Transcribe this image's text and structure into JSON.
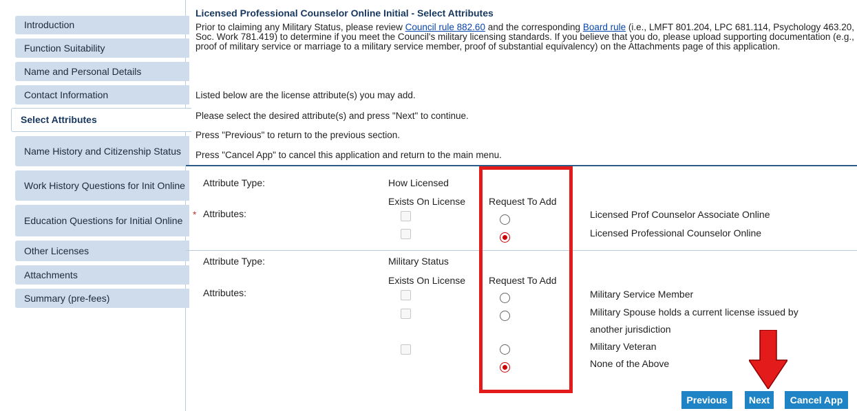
{
  "sidebar": {
    "items": [
      {
        "label": "Introduction"
      },
      {
        "label": "Function Suitability"
      },
      {
        "label": "Name and Personal Details"
      },
      {
        "label": "Contact Information"
      },
      {
        "label": "Select Attributes"
      },
      {
        "label": "Name History and Citizenship Status"
      },
      {
        "label": "Work History Questions for Init Online"
      },
      {
        "label": "Education Questions for Initial Online"
      },
      {
        "label": "Other Licenses"
      },
      {
        "label": "Attachments"
      },
      {
        "label": "Summary (pre-fees)"
      }
    ],
    "active_index": 4
  },
  "main": {
    "title": "Licensed Professional Counselor Online Initial - Select Attributes",
    "intro": {
      "pre": "Prior to claiming any Military Status, please review ",
      "link1": "Council rule 882.60",
      "mid": " and the corresponding ",
      "link2": "Board rule",
      "post": " (i.e., LMFT 801.204, LPC 681.114, Psychology 463.20, Soc. Work 781.419) to determine if you meet the Council's military licensing standards. If you believe that you do, please upload supporting documentation (e.g., proof of military service or marriage to a military service member, proof of substantial equivalency) on the Attachments page of this application."
    },
    "lines": [
      "Listed below are the license attribute(s) you may add.",
      "Please select the desired attribute(s) and press \"Next\" to continue.",
      "Press \"Previous\" to return to the previous section.",
      "Press \"Cancel App\" to cancel this application and return to the main menu."
    ]
  },
  "sections": [
    {
      "type_label": "Attribute Type:",
      "type_value": "How Licensed",
      "col_exists": "Exists On License",
      "col_request": "Request To Add",
      "required_marker": "*",
      "attributes_label": "Attributes:",
      "options": [
        {
          "label": "Licensed Prof Counselor Associate Online",
          "checked": false
        },
        {
          "label": "Licensed Professional Counselor Online",
          "checked": true
        }
      ]
    },
    {
      "type_label": "Attribute Type:",
      "type_value": "Military Status",
      "col_exists": "Exists On License",
      "col_request": "Request To Add",
      "attributes_label": "Attributes:",
      "options": [
        {
          "label": "Military Service Member",
          "checked": false
        },
        {
          "label": "Military Spouse holds a current license issued by",
          "label2": "another jurisdiction",
          "checked": false
        },
        {
          "label": "Military Veteran",
          "checked": false
        },
        {
          "label": "None of the Above",
          "checked": true
        }
      ]
    }
  ],
  "buttons": {
    "previous": "Previous",
    "next": "Next",
    "cancel": "Cancel App"
  },
  "colors": {
    "annotation": "#e31b1b",
    "button": "#1e84c5",
    "sidebar": "#cfdcec"
  }
}
